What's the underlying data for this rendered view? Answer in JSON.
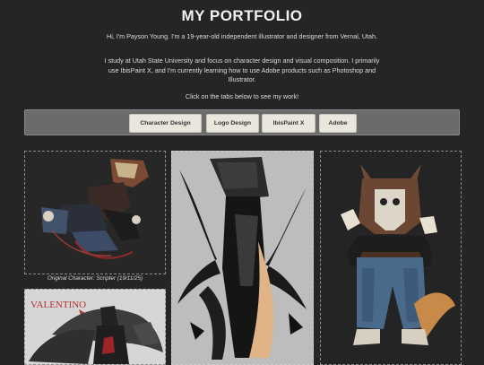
{
  "header": {
    "title": "MY PORTFOLIO"
  },
  "intro": {
    "line1": "Hi, I'm Payson Young. I'm a 19-year-old independent illustrator and designer from Vernal, Utah.",
    "line2": "I study at Utah State University and focus on character design and visual composition. I primarily use IbisPaint X, and I'm currently learning how to use Adobe products such as Photoshop and Illustrator.",
    "line3": "Click on the tabs below to see my work!"
  },
  "tabs": [
    {
      "label": "Character Design"
    },
    {
      "label": "Logo Design"
    },
    {
      "label": "IbisPaint X"
    },
    {
      "label": "Adobe"
    }
  ],
  "gallery": {
    "caption1": "Original Character: Scripter (19/11/25)",
    "artwork4_text": "VALENTINO"
  },
  "colors": {
    "background": "#252525",
    "tab_bar": "#6b6b6b",
    "tab_button": "#e9e6de",
    "text": "#e6e6e6"
  }
}
